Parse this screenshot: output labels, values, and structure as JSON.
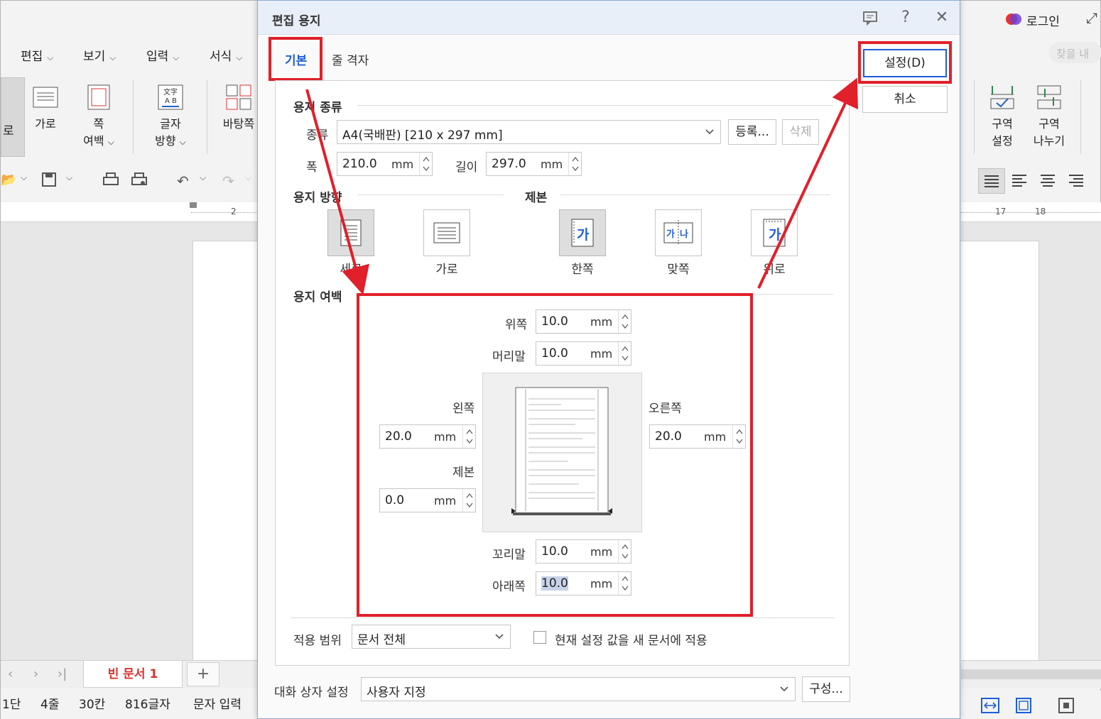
{
  "dialog": {
    "title": "편집 용지",
    "tabs": [
      {
        "label": "기본"
      },
      {
        "label": "줄 격자"
      }
    ],
    "buttons": {
      "ok": "설정(D)",
      "cancel": "취소"
    },
    "paper_type": {
      "section": "용지 종류",
      "type_label": "종류",
      "type_value": "A4(국배판)  [210 x 297 mm]",
      "register": "등록...",
      "delete": "삭제",
      "width_label": "폭",
      "width_value": "210.0",
      "length_label": "길이",
      "length_value": "297.0",
      "unit": "mm"
    },
    "orientation": {
      "section": "용지 방향",
      "portrait": "세로",
      "landscape": "가로"
    },
    "binding": {
      "section": "제본",
      "single": "한쪽",
      "facing": "맞쪽",
      "top": "위로",
      "glyph": "가",
      "glyph2": "나"
    },
    "margins": {
      "section": "용지 여백",
      "top_label": "위쪽",
      "top_value": "10.0",
      "header_label": "머리말",
      "header_value": "10.0",
      "left_label": "왼쪽",
      "left_value": "20.0",
      "right_label": "오른쪽",
      "right_value": "20.0",
      "gutter_label": "제본",
      "gutter_value": "0.0",
      "footer_label": "꼬리말",
      "footer_value": "10.0",
      "bottom_label": "아래쪽",
      "bottom_value": "10.0"
    },
    "apply": {
      "label": "적용 범위",
      "value": "문서 전체",
      "checkbox_label": "현재 설정 값을 새 문서에 적용"
    },
    "dialog_settings": {
      "label": "대화 상자 설정",
      "value": "사용자 지정",
      "configure": "구성..."
    }
  },
  "app": {
    "menus": [
      "편집",
      "보기",
      "입력",
      "서식"
    ],
    "login": "로그인",
    "search_hint": "찾을 내",
    "ribbon_left": [
      {
        "label": "로"
      },
      {
        "label": "가로"
      },
      {
        "label": "쪽",
        "label2": "여백"
      },
      {
        "label": "글자",
        "label2": "방향"
      },
      {
        "label": "바탕쪽"
      }
    ],
    "ribbon_right": [
      {
        "label": "구역",
        "label2": "설정"
      },
      {
        "label": "구역",
        "label2": "나누기"
      }
    ],
    "ruler_left": [
      "2"
    ],
    "ruler_right": [
      "17",
      "18"
    ],
    "doc_tab": "빈 문서 1",
    "status": [
      "1단",
      "4줄",
      "30칸",
      "816글자",
      "문자 입력"
    ]
  },
  "colors": {
    "accent": "#1e5fd6",
    "highlight": "#e0202a"
  }
}
